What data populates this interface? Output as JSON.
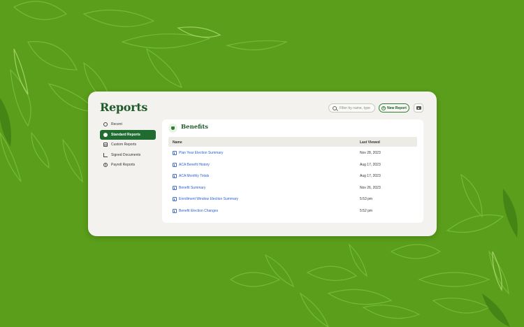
{
  "app": {
    "title": "Reports"
  },
  "header": {
    "search_placeholder": "Filter by name, type",
    "new_report_label": "New Report"
  },
  "sidebar": {
    "items": [
      {
        "label": "Recent",
        "icon": "clock-icon",
        "active": false
      },
      {
        "label": "Standard Reports",
        "icon": "pie-chart-icon",
        "active": true
      },
      {
        "label": "Custom Reports",
        "icon": "table-icon",
        "active": false
      },
      {
        "label": "Signed Documents",
        "icon": "signal-icon",
        "active": false
      },
      {
        "label": "Payroll Reports",
        "icon": "dollar-icon",
        "active": false
      }
    ]
  },
  "panel": {
    "title": "Benefits",
    "columns": [
      "Name",
      "Last Viewed"
    ],
    "rows": [
      {
        "name": "Plan Year Election Summary",
        "last_viewed": "Nov 28, 2023"
      },
      {
        "name": "ACA Benefit History",
        "last_viewed": "Aug 17, 2023"
      },
      {
        "name": "ACA Monthly Totals",
        "last_viewed": "Aug 17, 2023"
      },
      {
        "name": "Benefit Summary",
        "last_viewed": "Nov 26, 2023"
      },
      {
        "name": "Enrollment Window Election Summary",
        "last_viewed": "5:53 pm"
      },
      {
        "name": "Benefit Election Changes",
        "last_viewed": "5:52 pm"
      }
    ]
  },
  "colors": {
    "background": "#5a9e1b",
    "brand_green": "#1e5a2a",
    "active_nav": "#1f6b30",
    "link_blue": "#2a5fd0"
  }
}
